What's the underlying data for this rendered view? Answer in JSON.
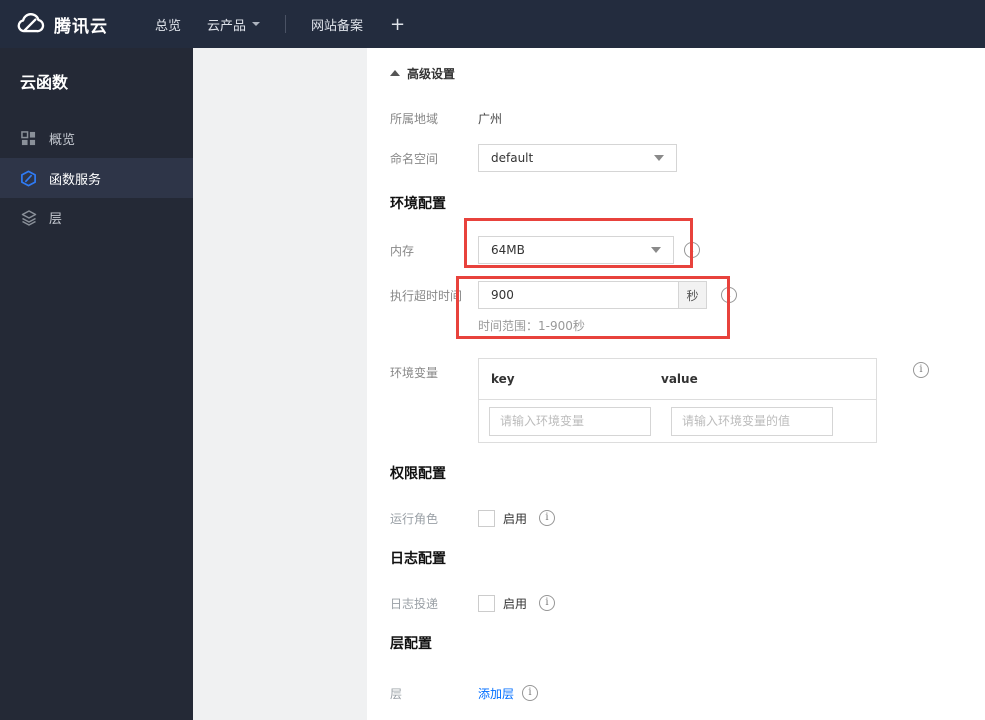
{
  "topbar": {
    "brand": "腾讯云",
    "nav_overview": "总览",
    "nav_products": "云产品",
    "nav_icp": "网站备案",
    "nav_plus": "+"
  },
  "sidebar": {
    "title": "云函数",
    "items": [
      {
        "label": "概览",
        "icon": "grid-icon",
        "active": false
      },
      {
        "label": "函数服务",
        "icon": "function-hexagon-icon",
        "active": true
      },
      {
        "label": "层",
        "icon": "layers-icon",
        "active": false
      }
    ]
  },
  "form": {
    "advanced_header": "高级设置",
    "region": {
      "label": "所属地域",
      "value": "广州"
    },
    "namespace": {
      "label": "命名空间",
      "value": "default"
    },
    "section_env": "环境配置",
    "memory": {
      "label": "内存",
      "value": "64MB"
    },
    "timeout": {
      "label": "执行超时时间",
      "value": "900",
      "unit": "秒",
      "hint": "时间范围：1-900秒"
    },
    "env_vars": {
      "label": "环境变量",
      "col_key": "key",
      "col_value": "value",
      "key_placeholder": "请输入环境变量",
      "value_placeholder": "请输入环境变量的值"
    },
    "section_perm": "权限配置",
    "role": {
      "label": "运行角色",
      "checkbox_label": "启用"
    },
    "section_log": "日志配置",
    "log": {
      "label": "日志投递",
      "checkbox_label": "启用"
    },
    "section_layer": "层配置",
    "layer": {
      "label": "层",
      "link_label": "添加层"
    }
  },
  "icons": {
    "info": "i"
  },
  "colors": {
    "highlight_red": "#e8423c",
    "link_blue": "#006eff",
    "sidebar_active_blue": "#2f7bf5",
    "topbar_bg": "#232c3e",
    "sidebar_bg": "#242936"
  }
}
